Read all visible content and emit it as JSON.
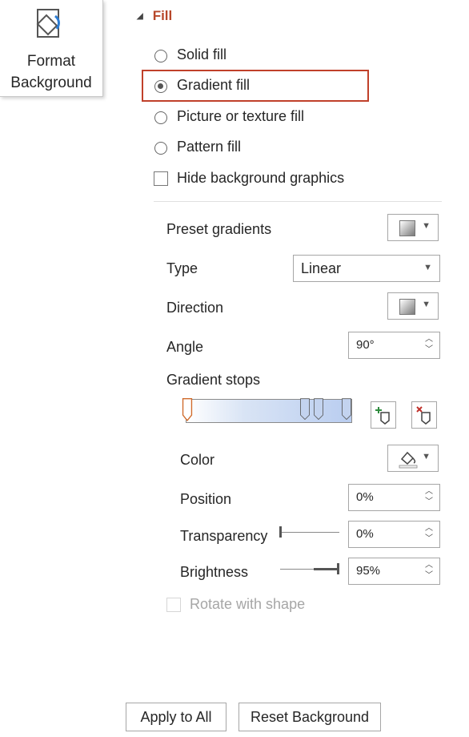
{
  "ribbon": {
    "label_line1": "Format",
    "label_line2": "Background",
    "icon": "format-background-icon"
  },
  "section": {
    "title": "Fill"
  },
  "fill_options": {
    "solid": "Solid fill",
    "gradient": "Gradient fill",
    "picture": "Picture or texture fill",
    "pattern": "Pattern fill",
    "selected": "Gradient fill"
  },
  "hide_graphics": {
    "label": "Hide background graphics",
    "checked": false
  },
  "gradient": {
    "preset_label": "Preset gradients",
    "type_label": "Type",
    "type_value": "Linear",
    "direction_label": "Direction",
    "angle_label": "Angle",
    "angle_value": "90°",
    "stops_label": "Gradient stops",
    "color_label": "Color",
    "position_label": "Position",
    "position_value": "0%",
    "transparency_label": "Transparency",
    "transparency_value": "0%",
    "brightness_label": "Brightness",
    "brightness_value": "95%",
    "rotate_label": "Rotate with shape"
  },
  "footer": {
    "apply_all": "Apply to All",
    "reset": "Reset Background"
  },
  "colors": {
    "accent": "#b7472a",
    "highlight": "#c0402a",
    "stop_selected": "#d06a2a"
  }
}
